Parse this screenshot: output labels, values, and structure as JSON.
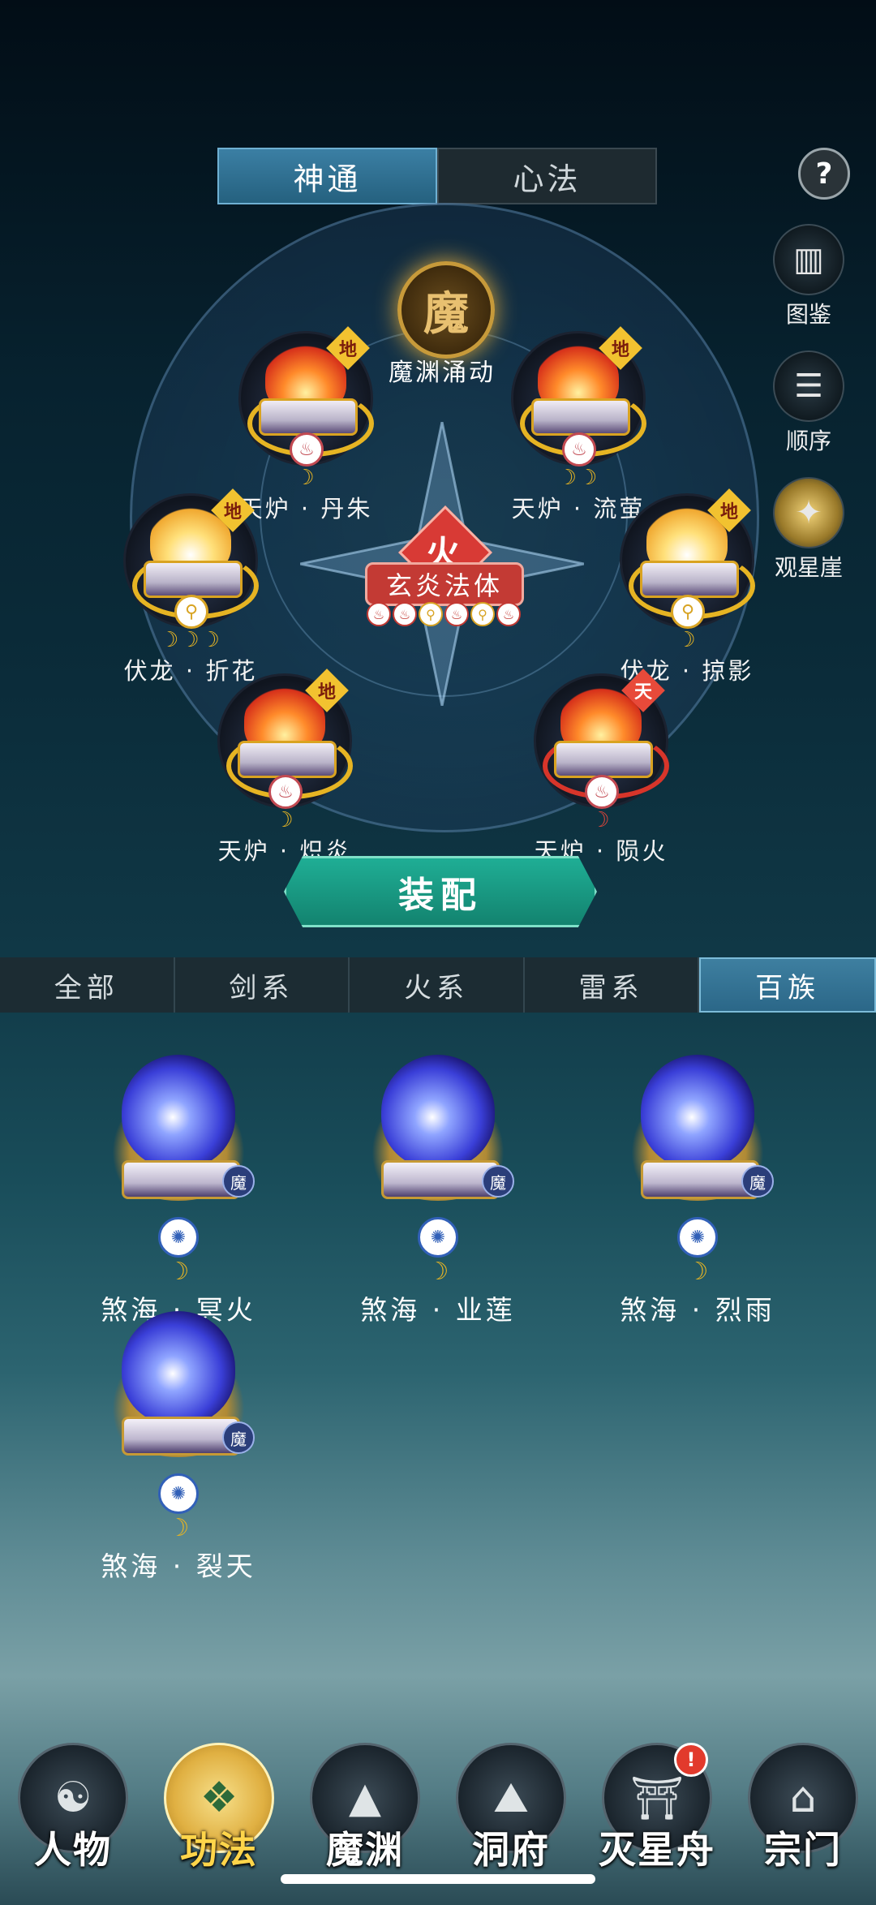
{
  "top_tabs": [
    {
      "label": "神通"
    },
    {
      "label": "心法"
    }
  ],
  "help": {
    "label": "?"
  },
  "side": {
    "tujian": {
      "label": "图鉴",
      "icon": "book-icon"
    },
    "shunxu": {
      "label": "顺序",
      "icon": "sort-icon"
    },
    "guanxingya": {
      "label": "观星崖",
      "icon": "star-tower-icon"
    }
  },
  "center": {
    "demon_glyph": "魔",
    "demon_skill": "魔渊涌动",
    "element": "火",
    "body_name": "玄炎法体"
  },
  "slots": [
    {
      "name": "天炉 · 丹朱",
      "grade": "地",
      "moons": "☽"
    },
    {
      "name": "天炉 · 流萤",
      "grade": "地",
      "moons": "☽☽"
    },
    {
      "name": "伏龙 · 折花",
      "grade": "地",
      "moons": "☽☽☽"
    },
    {
      "name": "伏龙 · 掠影",
      "grade": "地",
      "moons": "☽"
    },
    {
      "name": "天炉 · 炽炎",
      "grade": "地",
      "moons": "☽"
    },
    {
      "name": "天炉 · 陨火",
      "grade": "天",
      "moons": "☽"
    }
  ],
  "equip_button": "装配",
  "filter_tabs": [
    {
      "label": "全部"
    },
    {
      "label": "剑系"
    },
    {
      "label": "火系"
    },
    {
      "label": "雷系"
    },
    {
      "label": "百族"
    }
  ],
  "cards": [
    {
      "name": "煞海 · 冥火",
      "badge": "魔"
    },
    {
      "name": "煞海 · 业莲",
      "badge": "魔"
    },
    {
      "name": "煞海 · 烈雨",
      "badge": "魔"
    },
    {
      "name": "煞海 · 裂天",
      "badge": "魔"
    }
  ],
  "nav": [
    {
      "label": "人物",
      "icon": "character-icon"
    },
    {
      "label": "功法",
      "icon": "technique-icon"
    },
    {
      "label": "魔渊",
      "icon": "abyss-icon"
    },
    {
      "label": "洞府",
      "icon": "cave-icon"
    },
    {
      "label": "灭星舟",
      "icon": "ship-icon",
      "badge": "!"
    },
    {
      "label": "宗门",
      "icon": "sect-icon"
    }
  ],
  "colors": {
    "fire": "#d83a35",
    "gold": "#e6b423",
    "teal": "#1fae95",
    "active_tab": "#3b7fa4"
  }
}
